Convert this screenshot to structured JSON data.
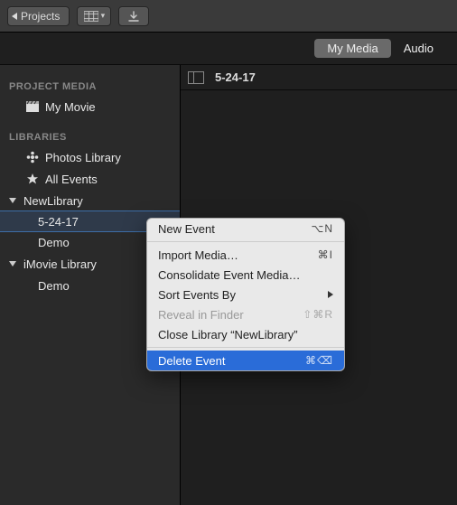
{
  "toolbar": {
    "projects_label": "Projects"
  },
  "tabs": {
    "my_media": "My Media",
    "audio": "Audio"
  },
  "sidebar": {
    "section_project_media": "PROJECT MEDIA",
    "my_movie": "My Movie",
    "section_libraries": "LIBRARIES",
    "photos_library": "Photos Library",
    "all_events": "All Events",
    "newlibrary": "NewLibrary",
    "newlibrary_child1": "5-24-17",
    "newlibrary_child2": "Demo",
    "imovie_library": "iMovie Library",
    "imovie_child1": "Demo"
  },
  "content": {
    "title": "5-24-17"
  },
  "menu": {
    "new_event": "New Event",
    "new_event_shortcut": "⌥N",
    "import_media": "Import Media…",
    "import_media_shortcut": "⌘I",
    "consolidate": "Consolidate Event Media…",
    "sort_by": "Sort Events By",
    "reveal": "Reveal in Finder",
    "reveal_shortcut": "⇧⌘R",
    "close_library": "Close Library “NewLibrary”",
    "delete_event": "Delete Event",
    "delete_event_shortcut": "⌘⌫"
  }
}
